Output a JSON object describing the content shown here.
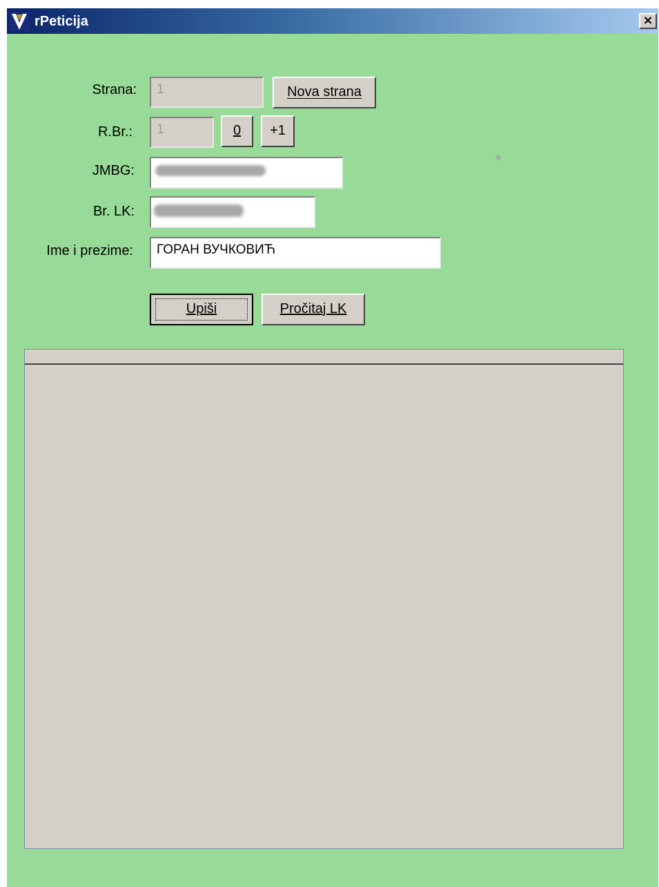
{
  "window": {
    "title": "rPeticija",
    "close_label": "×"
  },
  "form": {
    "strana": {
      "label": "Strana:",
      "value": "1"
    },
    "rbr": {
      "label": "R.Br.:",
      "value": "1"
    },
    "jmbg": {
      "label": "JMBG:",
      "value": ""
    },
    "brlk": {
      "label": "Br. LK:",
      "value": ""
    },
    "ime": {
      "label": "Ime i prezime:",
      "value": "ГОРАН ВУЧКОВИЋ"
    }
  },
  "buttons": {
    "nova_strana": "Nova strana",
    "zero": "0",
    "plus_one": "+1",
    "upisi": "Upiši",
    "procitaj": "Pročitaj LK"
  },
  "colors": {
    "window_bg": "#98da98",
    "panel_bg": "#d4d0c8",
    "title_start": "#0a246a"
  }
}
